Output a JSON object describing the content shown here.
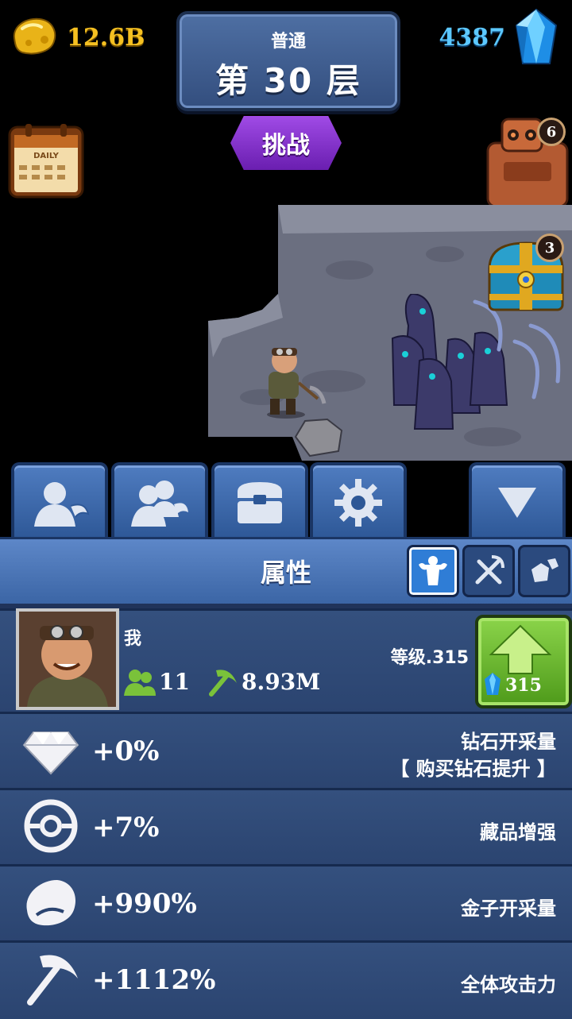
{
  "hud": {
    "gold": "12.6B",
    "gems": "4387"
  },
  "floor": {
    "mode": "普通",
    "level": "第 30 层"
  },
  "challenge_label": "挑战",
  "daily_label": "DAILY",
  "robot_badge": "6",
  "chest_badge": "3",
  "panel": {
    "title": "属性"
  },
  "player": {
    "name": "我",
    "workers": "11",
    "power": "8.93M",
    "level": "等级.315",
    "upgrade_cost": "315"
  },
  "stats": [
    {
      "value": "+0%",
      "label": "钻石开采量",
      "sublabel": "【 购买钻石提升 】",
      "icon": "diamond-icon"
    },
    {
      "value": "+7%",
      "label": "藏品增强",
      "icon": "collection-ring-icon"
    },
    {
      "value": "+990%",
      "label": "金子开采量",
      "icon": "gold-nugget-icon"
    },
    {
      "value": "+1112%",
      "label": "全体攻击力",
      "icon": "pickaxe-icon"
    }
  ],
  "colors": {
    "gold": "#f5c021",
    "gem": "#5cc8ff",
    "challenge": "#8a34d4",
    "upgrade": "#6cbf2e",
    "panel": "#2b4470"
  }
}
